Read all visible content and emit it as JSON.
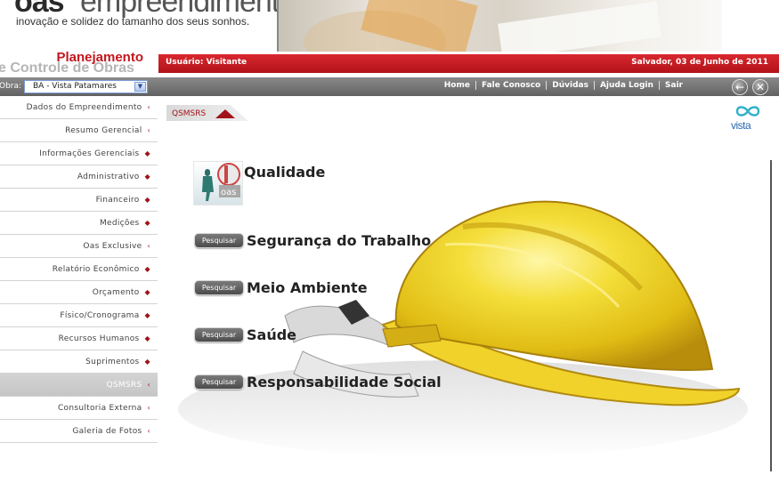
{
  "header": {
    "brand_oas": "oas",
    "brand_empreendimentos": "empreendimentos",
    "tagline": "inovação e solidez do tamanho dos seus sonhos.",
    "system_title": "Planejamento",
    "system_subtitle": "e Controle de Obras"
  },
  "status_bar": {
    "user": "Usuário: Visitante",
    "date": "Salvador, 03 de Junho de 2011"
  },
  "obra": {
    "label": "Obra:",
    "selected": "BA - Vista Patamares"
  },
  "top_nav": [
    "Home",
    "Fale Conosco",
    "Dúvidas",
    "Ajuda Login",
    "Sair"
  ],
  "sidebar": {
    "items": [
      {
        "label": "Dados do Empreendimento",
        "arrow": "‹"
      },
      {
        "label": "Resumo Gerencial",
        "arrow": "‹"
      },
      {
        "label": "Informações Gerenciais",
        "arrow": "◆"
      },
      {
        "label": "Administrativo",
        "arrow": "◆"
      },
      {
        "label": "Financeiro",
        "arrow": "◆"
      },
      {
        "label": "Medições",
        "arrow": "◆"
      },
      {
        "label": "Oas Exclusive",
        "arrow": "‹"
      },
      {
        "label": "Relatório Econômico",
        "arrow": "◆"
      },
      {
        "label": "Orçamento",
        "arrow": "◆"
      },
      {
        "label": "Físico/Cronograma",
        "arrow": "◆"
      },
      {
        "label": "Recursos Humanos",
        "arrow": "◆"
      },
      {
        "label": "Suprimentos",
        "arrow": "◆"
      },
      {
        "label": "QSMSRS",
        "arrow": "‹",
        "active": true
      },
      {
        "label": "Consultoria Externa",
        "arrow": "‹"
      },
      {
        "label": "Galeria de Fotos",
        "arrow": "‹"
      }
    ]
  },
  "breadcrumb": "QSMSRS",
  "partner_logo": "vista",
  "content": {
    "qualidade": "Qualidade",
    "button_label": "Pesquisar",
    "rows": [
      "Segurança do Trabalho",
      "Meio Ambiente",
      "Saúde",
      "Responsabilidade Social"
    ]
  },
  "colors": {
    "brand_red": "#c4161c",
    "nav_gray": "#6f6f6f",
    "helmet_yellow": "#f2d324"
  }
}
